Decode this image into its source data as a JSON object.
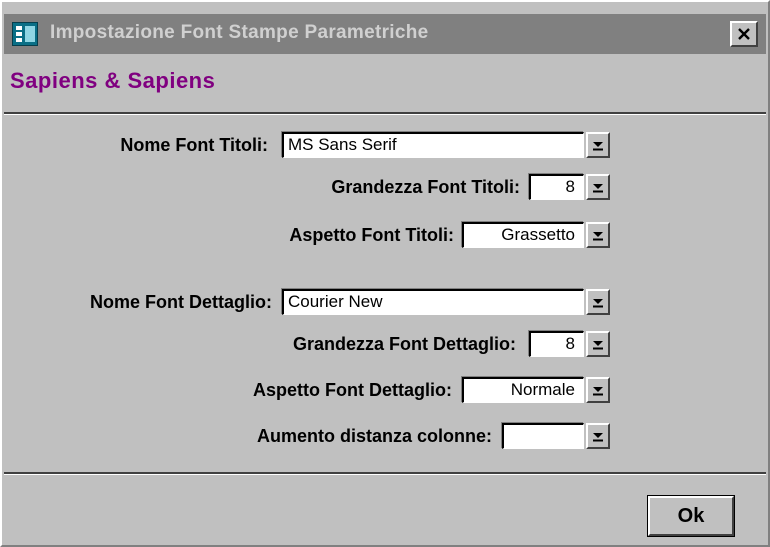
{
  "window": {
    "title": "Impostazione Font Stampe Parametriche",
    "heading": "Sapiens & Sapiens",
    "icon": "app-form-icon",
    "close_icon": "close-icon"
  },
  "form": {
    "nome_font_titoli": {
      "label": "Nome Font Titoli:",
      "value": "MS Sans Serif"
    },
    "grandezza_font_titoli": {
      "label": "Grandezza Font Titoli:",
      "value": "8"
    },
    "aspetto_font_titoli": {
      "label": "Aspetto Font Titoli:",
      "value": "Grassetto"
    },
    "nome_font_dettaglio": {
      "label": "Nome Font Dettaglio:",
      "value": "Courier New"
    },
    "grandezza_font_dettaglio": {
      "label": "Grandezza Font Dettaglio:",
      "value": "8"
    },
    "aspetto_font_dettaglio": {
      "label": "Aspetto Font Dettaglio:",
      "value": "Normale"
    },
    "aumento_distanza_colonne": {
      "label": "Aumento distanza colonne:",
      "value": ""
    }
  },
  "buttons": {
    "ok_label": "Ok"
  },
  "colors": {
    "dialog_bg": "#c0c0c0",
    "titlebar_inactive": "#808080",
    "heading_purple": "#800080"
  }
}
